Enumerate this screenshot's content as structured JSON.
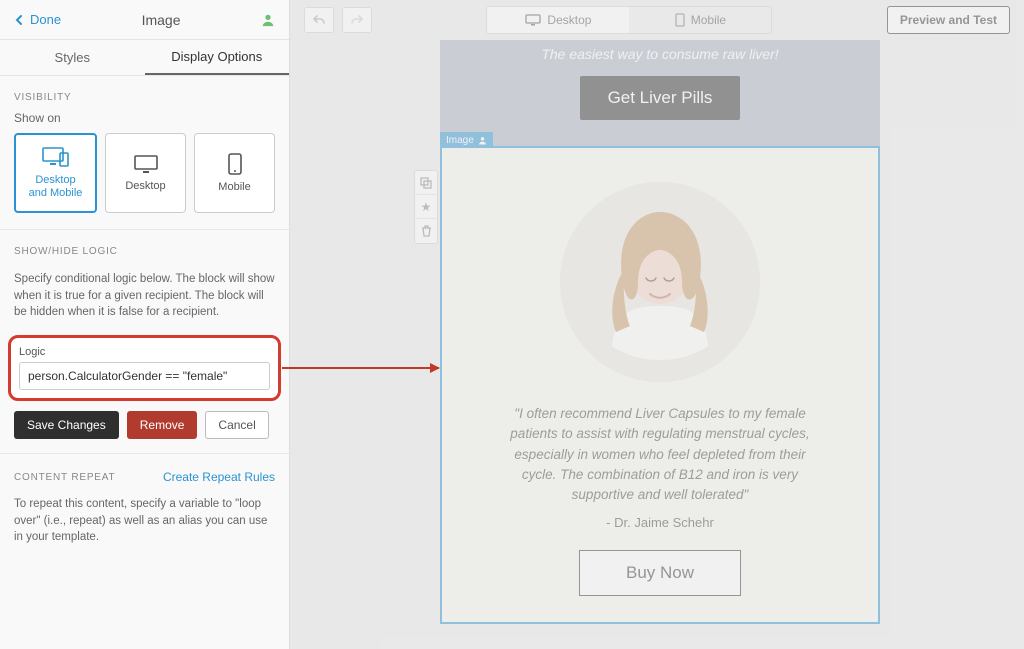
{
  "header": {
    "back": "Done",
    "title": "Image"
  },
  "tabs": {
    "styles": "Styles",
    "display": "Display Options"
  },
  "visibility": {
    "section": "VISIBILITY",
    "show_on": "Show on",
    "cards": {
      "both": "Desktop\nand Mobile",
      "desktop": "Desktop",
      "mobile": "Mobile"
    }
  },
  "logic": {
    "section": "SHOW/HIDE LOGIC",
    "desc": "Specify conditional logic below. The block will show when it is true for a given recipient. The block will be hidden when it is false for a recipient.",
    "label": "Logic",
    "value": "person.CalculatorGender == \"female\"",
    "save": "Save Changes",
    "remove": "Remove",
    "cancel": "Cancel"
  },
  "repeat": {
    "section": "CONTENT REPEAT",
    "link": "Create Repeat Rules",
    "desc": "To repeat this content, specify a variable to \"loop over\" (i.e., repeat) as well as an alias you can use in your template."
  },
  "canvas": {
    "view": {
      "desktop": "Desktop",
      "mobile": "Mobile"
    },
    "preview": "Preview and Test",
    "hero": {
      "sub": "The easiest way to consume raw liver!",
      "cta": "Get Liver Pills"
    },
    "block": {
      "tag": "Image",
      "quote": "\"I often recommend Liver Capsules to my female patients to assist with regulating menstrual cycles, especially in women who feel depleted from their cycle. The combination of B12 and iron is very supportive and well tolerated\"",
      "attrib": "-  Dr. Jaime Schehr",
      "buy": "Buy Now"
    }
  }
}
